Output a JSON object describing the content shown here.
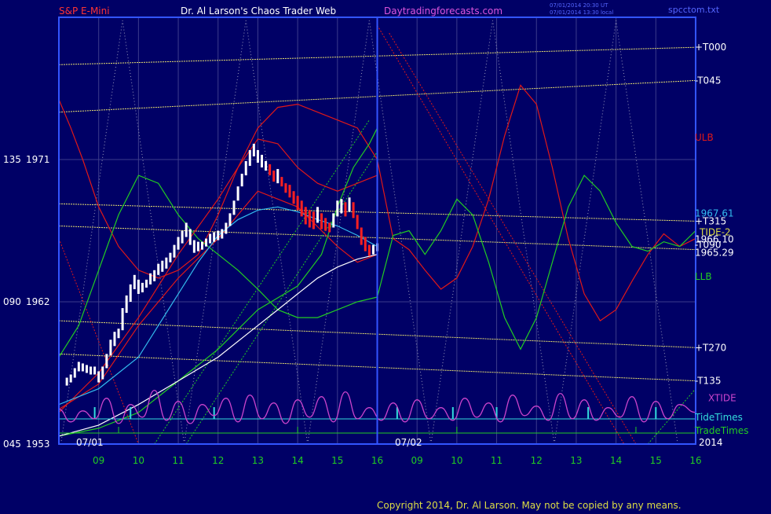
{
  "header": {
    "symbol": "S&P E-Mini",
    "title": "Dr. Al Larson's Chaos Trader Web",
    "site": "Daytradingforecasts.com",
    "stamp1": "07/01/2014 20:30 UT",
    "stamp2": "07/01/2014 13:30 local",
    "file": "spcctom.txt"
  },
  "footer": {
    "copyright": "Copyright 2014, Dr. Al Larson. May not be copied by any means."
  },
  "colors": {
    "background": "#000066",
    "frame": "#3355ff",
    "grid": "#3c3c8c",
    "price": "#ffffff",
    "down_bar": "#ff2020",
    "tide_red": "#e01818",
    "tide_green": "#22cc22",
    "yellow_line": "#e8e070",
    "xtide": "#cc44cc",
    "ma_cyan": "#33bbee",
    "tide_times": "#33dddd",
    "trade_times": "#22cc22"
  },
  "chart_data": {
    "type": "line",
    "y_axis_labels": [
      {
        "angle": "135",
        "price": "1971",
        "value": 1971
      },
      {
        "angle": "090",
        "price": "1962",
        "value": 1962
      },
      {
        "angle": "045",
        "price": "1953",
        "value": 1953
      }
    ],
    "ylim": [
      1953,
      1980
    ],
    "x_ticks_day1": [
      "09",
      "10",
      "11",
      "12",
      "13",
      "14",
      "15",
      "16"
    ],
    "x_ticks_day2": [
      "09",
      "10",
      "11",
      "12",
      "13",
      "14",
      "15",
      "16"
    ],
    "date_labels": {
      "day1": "07/01",
      "day2": "07/02",
      "year": "2014"
    },
    "right_labels": [
      {
        "text": "+T000",
        "value": 1978.1,
        "color": "#ffffff"
      },
      {
        "text": "-T045",
        "value": 1976.0,
        "color": "#ffffff"
      },
      {
        "text": "ULB",
        "value": 1972.4,
        "color": "#e01818"
      },
      {
        "text": "1967.61",
        "value": 1967.6,
        "color": "#33bbee"
      },
      {
        "text": "+T315",
        "value": 1967.1,
        "color": "#ffffff"
      },
      {
        "text": "TIDE-2",
        "value": 1966.4,
        "color": "#dddd44"
      },
      {
        "text": "1966.10",
        "value": 1965.95,
        "color": "#ffffff"
      },
      {
        "text": "-T090",
        "value": 1965.6,
        "color": "#ffffff"
      },
      {
        "text": "1965.29",
        "value": 1965.1,
        "color": "#ffffff"
      },
      {
        "text": "LLB",
        "value": 1963.6,
        "color": "#22cc22"
      },
      {
        "text": "+T270",
        "value": 1959.1,
        "color": "#ffffff"
      },
      {
        "text": "-T135",
        "value": 1957.0,
        "color": "#ffffff"
      },
      {
        "text": "XTIDE",
        "value": 1955.9,
        "color": "#cc44cc"
      },
      {
        "text": "TideTimes",
        "value": 1954.8,
        "color": "#33dddd"
      },
      {
        "text": "TradeTimes",
        "value": 1953.8,
        "color": "#22cc22"
      }
    ],
    "price_bars": [
      [
        8.2,
        1957.2,
        1956.7
      ],
      [
        8.3,
        1957.4,
        1956.9
      ],
      [
        8.4,
        1957.8,
        1957.2
      ],
      [
        8.5,
        1958.2,
        1957.6
      ],
      [
        8.6,
        1958.1,
        1957.6
      ],
      [
        8.7,
        1958.0,
        1957.5
      ],
      [
        8.8,
        1957.9,
        1957.4
      ],
      [
        8.9,
        1957.9,
        1957.4
      ],
      [
        9.0,
        1957.6,
        1956.9
      ],
      [
        9.1,
        1957.9,
        1957.1
      ],
      [
        9.2,
        1958.7,
        1957.8
      ],
      [
        9.3,
        1959.6,
        1958.6
      ],
      [
        9.4,
        1960.1,
        1959.2
      ],
      [
        9.5,
        1960.3,
        1959.7
      ],
      [
        9.6,
        1961.6,
        1960.2
      ],
      [
        9.7,
        1962.4,
        1961.3
      ],
      [
        9.8,
        1963.1,
        1962.0
      ],
      [
        9.9,
        1963.7,
        1962.8
      ],
      [
        10.0,
        1963.4,
        1962.5
      ],
      [
        10.1,
        1963.2,
        1962.6
      ],
      [
        10.2,
        1963.4,
        1962.9
      ],
      [
        10.3,
        1963.8,
        1963.1
      ],
      [
        10.4,
        1964.0,
        1963.3
      ],
      [
        10.5,
        1964.4,
        1963.7
      ],
      [
        10.6,
        1964.6,
        1963.9
      ],
      [
        10.7,
        1964.8,
        1964.1
      ],
      [
        10.8,
        1965.1,
        1964.5
      ],
      [
        10.9,
        1965.6,
        1964.8
      ],
      [
        11.0,
        1966.1,
        1965.3
      ],
      [
        11.1,
        1966.5,
        1965.7
      ],
      [
        11.2,
        1967.0,
        1966.1
      ],
      [
        11.3,
        1966.6,
        1965.6
      ],
      [
        11.4,
        1965.9,
        1965.1
      ],
      [
        11.5,
        1965.8,
        1965.2
      ],
      [
        11.6,
        1965.8,
        1965.3
      ],
      [
        11.7,
        1966.0,
        1965.5
      ],
      [
        11.8,
        1966.3,
        1965.7
      ],
      [
        11.9,
        1966.4,
        1965.8
      ],
      [
        12.0,
        1966.5,
        1965.9
      ],
      [
        12.1,
        1966.6,
        1966.0
      ],
      [
        12.2,
        1967.0,
        1966.3
      ],
      [
        12.3,
        1967.6,
        1966.8
      ],
      [
        12.4,
        1968.4,
        1967.5
      ],
      [
        12.5,
        1969.3,
        1968.4
      ],
      [
        12.6,
        1970.1,
        1969.3
      ],
      [
        12.7,
        1970.9,
        1970.0
      ],
      [
        12.8,
        1971.6,
        1970.6
      ],
      [
        12.9,
        1972.0,
        1971.2
      ],
      [
        13.0,
        1971.6,
        1970.8
      ],
      [
        13.1,
        1971.3,
        1970.5
      ],
      [
        13.2,
        1970.9,
        1970.3
      ],
      [
        13.3,
        1970.7,
        1970.0
      ],
      [
        13.4,
        1970.3,
        1969.6
      ],
      [
        13.5,
        1970.4,
        1969.5
      ],
      [
        13.6,
        1969.9,
        1969.3
      ],
      [
        13.7,
        1969.5,
        1968.9
      ],
      [
        13.8,
        1969.4,
        1968.6
      ],
      [
        13.9,
        1969.0,
        1968.2
      ],
      [
        14.0,
        1968.7,
        1967.8
      ],
      [
        14.1,
        1968.4,
        1967.4
      ],
      [
        14.2,
        1968.0,
        1966.9
      ],
      [
        14.3,
        1967.8,
        1966.7
      ],
      [
        14.4,
        1967.7,
        1966.6
      ],
      [
        14.5,
        1968.0,
        1967.0
      ],
      [
        14.6,
        1967.6,
        1966.6
      ],
      [
        14.7,
        1967.3,
        1966.5
      ],
      [
        14.8,
        1967.0,
        1966.4
      ],
      [
        14.9,
        1967.6,
        1966.7
      ],
      [
        15.0,
        1968.4,
        1967.4
      ],
      [
        15.1,
        1968.5,
        1967.6
      ],
      [
        15.2,
        1968.3,
        1967.4
      ],
      [
        15.3,
        1968.6,
        1967.7
      ],
      [
        15.4,
        1968.3,
        1967.3
      ],
      [
        15.5,
        1967.5,
        1966.6
      ],
      [
        15.6,
        1966.7,
        1965.6
      ],
      [
        15.7,
        1966.1,
        1965.2
      ],
      [
        15.8,
        1965.6,
        1964.9
      ],
      [
        15.9,
        1965.6,
        1965.0
      ],
      [
        16.0,
        1965.7,
        1965.2
      ]
    ],
    "series": [
      {
        "key": "ulb_red",
        "color": "#e01818",
        "x": [
          8.0,
          8.3,
          8.6,
          9.0,
          9.5,
          10.0,
          10.5,
          11.0,
          11.5,
          12.0,
          12.5,
          13.0,
          13.5,
          14.0,
          14.5,
          15.0,
          15.5,
          16.0,
          16.4,
          16.8,
          17.2,
          17.6,
          18.0,
          18.4,
          18.8,
          19.2,
          19.6,
          20.0,
          20.4,
          20.8,
          21.2,
          21.6,
          22.0,
          22.4,
          22.8,
          23.2,
          23.6,
          24.0
        ],
        "values": [
          1974.8,
          1973.0,
          1971.0,
          1968.0,
          1965.5,
          1964.0,
          1963.5,
          1964.0,
          1965.0,
          1967.5,
          1970.5,
          1973.0,
          1974.3,
          1974.5,
          1974.0,
          1973.5,
          1973.0,
          1971.0,
          1966.0,
          1965.3,
          1964.0,
          1962.8,
          1963.5,
          1965.5,
          1968.5,
          1972.5,
          1975.7,
          1974.5,
          1970.5,
          1966.0,
          1962.5,
          1960.8,
          1961.5,
          1963.3,
          1965.0,
          1966.3,
          1965.5,
          1966.0
        ]
      },
      {
        "key": "llb_green",
        "color": "#22cc22",
        "x": [
          8.0,
          8.5,
          9.0,
          9.5,
          10.0,
          10.5,
          11.0,
          11.5,
          12.0,
          12.5,
          13.0,
          13.5,
          14.0,
          14.5,
          15.0,
          15.5,
          16.0,
          16.4,
          16.8,
          17.2,
          17.6,
          18.0,
          18.4,
          18.8,
          19.2,
          19.6,
          20.0,
          20.4,
          20.8,
          21.2,
          21.6,
          22.0,
          22.4,
          22.8,
          23.2,
          23.6,
          24.0
        ],
        "values": [
          1958.5,
          1960.5,
          1964.0,
          1967.5,
          1970.0,
          1969.5,
          1967.5,
          1966.0,
          1965.0,
          1964.0,
          1962.8,
          1961.5,
          1961.0,
          1961.0,
          1961.5,
          1962.0,
          1962.3,
          1966.2,
          1966.5,
          1965.0,
          1966.5,
          1968.5,
          1967.5,
          1964.5,
          1961.0,
          1959.0,
          1961.0,
          1964.5,
          1968.0,
          1970.0,
          1969.0,
          1967.0,
          1965.5,
          1965.2,
          1965.8,
          1965.5,
          1966.5
        ]
      },
      {
        "key": "red_envelope_upper",
        "color": "#e01818",
        "x": [
          8.0,
          9.0,
          10.0,
          11.0,
          12.0,
          12.5,
          13.0,
          13.5,
          14.0,
          14.5,
          15.0,
          15.5,
          16.0
        ],
        "values": [
          1955.0,
          1957.5,
          1961.0,
          1965.0,
          1968.5,
          1970.5,
          1972.3,
          1972.0,
          1970.5,
          1969.5,
          1969.0,
          1969.5,
          1970.0
        ]
      },
      {
        "key": "red_envelope_lower",
        "color": "#e01818",
        "x": [
          8.0,
          9.0,
          10.0,
          11.0,
          12.0,
          13.0,
          14.0,
          15.0,
          15.5,
          16.0
        ],
        "values": [
          1955.2,
          1956.8,
          1960.5,
          1963.5,
          1966.0,
          1969.0,
          1968.0,
          1965.5,
          1964.5,
          1965.0
        ]
      },
      {
        "key": "green_envelope",
        "color": "#22cc22",
        "x": [
          8.0,
          9.0,
          10.0,
          11.0,
          12.0,
          13.0,
          14.0,
          14.6,
          15.0,
          15.4,
          15.8,
          16.0
        ],
        "values": [
          1953.5,
          1954.0,
          1955.0,
          1957.0,
          1959.0,
          1961.5,
          1963.0,
          1965.0,
          1968.0,
          1970.5,
          1972.0,
          1973.0
        ]
      },
      {
        "key": "moving_average_cyan",
        "color": "#33bbee",
        "x": [
          8.0,
          9.0,
          10.0,
          10.5,
          11.0,
          11.5,
          12.0,
          12.5,
          13.0,
          13.5,
          14.0,
          14.5,
          15.0,
          15.5,
          16.0
        ],
        "values": [
          1955.5,
          1956.5,
          1958.5,
          1960.5,
          1962.5,
          1964.5,
          1966.2,
          1967.2,
          1967.8,
          1968.0,
          1967.7,
          1967.2,
          1966.8,
          1966.2,
          1965.5
        ]
      },
      {
        "key": "moving_average_white",
        "color": "#ffffff",
        "x": [
          8.0,
          9.0,
          10.0,
          11.0,
          12.0,
          13.0,
          13.5,
          14.0,
          14.5,
          15.0,
          15.5,
          16.0
        ],
        "values": [
          1953.5,
          1954.2,
          1955.5,
          1957.0,
          1958.5,
          1960.5,
          1961.5,
          1962.5,
          1963.5,
          1964.2,
          1964.7,
          1965.0
        ]
      },
      {
        "key": "yellow_T000",
        "color": "#e8e070",
        "x": [
          8.0,
          24.0
        ],
        "values": [
          1977.0,
          1978.1
        ]
      },
      {
        "key": "yellow_T045",
        "color": "#e8e070",
        "x": [
          8.0,
          24.0
        ],
        "values": [
          1974.0,
          1976.0
        ]
      },
      {
        "key": "yellow_T315",
        "color": "#e8e070",
        "x": [
          8.0,
          24.0
        ],
        "values": [
          1968.2,
          1967.1
        ]
      },
      {
        "key": "yellow_T090",
        "color": "#e8e070",
        "x": [
          8.0,
          24.0
        ],
        "values": [
          1966.8,
          1965.3
        ]
      },
      {
        "key": "yellow_T270",
        "color": "#e8e070",
        "x": [
          8.0,
          24.0
        ],
        "values": [
          1960.8,
          1959.1
        ]
      },
      {
        "key": "yellow_T135",
        "color": "#e8e070",
        "x": [
          8.0,
          24.0
        ],
        "values": [
          1958.7,
          1957.0
        ]
      }
    ],
    "xtide_series": {
      "color": "#cc44cc",
      "x": [
        8.0,
        8.3,
        8.6,
        8.9,
        9.2,
        9.5,
        9.8,
        10.1,
        10.4,
        10.7,
        11.0,
        11.3,
        11.6,
        11.9,
        12.2,
        12.5,
        12.8,
        13.1,
        13.4,
        13.7,
        14.0,
        14.3,
        14.6,
        14.9,
        15.2,
        15.5,
        15.8,
        16.1,
        16.4,
        16.7,
        17.0,
        17.3,
        17.6,
        17.9,
        18.2,
        18.5,
        18.8,
        19.1,
        19.4,
        19.7,
        20.0,
        20.3,
        20.6,
        20.9,
        21.2,
        21.5,
        21.8,
        22.1,
        22.4,
        22.7,
        23.0,
        23.3,
        23.6,
        24.0
      ],
      "values": [
        1955.2,
        1954.4,
        1955.1,
        1954.6,
        1955.9,
        1954.3,
        1955.5,
        1954.7,
        1956.4,
        1954.5,
        1955.7,
        1954.3,
        1955.5,
        1954.8,
        1955.9,
        1954.4,
        1956.1,
        1954.6,
        1955.6,
        1954.3,
        1955.8,
        1954.7,
        1956.0,
        1954.4,
        1956.3,
        1954.6,
        1955.3,
        1954.5,
        1955.6,
        1954.4,
        1955.8,
        1954.6,
        1955.3,
        1954.5,
        1955.9,
        1954.7,
        1955.6,
        1954.4,
        1956.1,
        1954.8,
        1955.4,
        1954.5,
        1956.2,
        1954.6,
        1955.8,
        1954.5,
        1955.3,
        1954.7,
        1956.0,
        1954.4,
        1955.7,
        1954.6,
        1955.5,
        1955.0
      ]
    },
    "tide_time_marks": [
      8.9,
      9.8,
      11.9,
      16.5,
      17.9,
      19.0,
      21.3,
      23.0
    ],
    "trade_time_marks": [
      9.5,
      14.0,
      18.0,
      22.5
    ],
    "diamond_lattice": {
      "top_value": 1979.8,
      "bottom_value": 1953.0,
      "peak_times": [
        9.6,
        12.7,
        15.8,
        18.9,
        22.0
      ],
      "trough_times": [
        8.05,
        11.15,
        14.25,
        17.35,
        20.45,
        23.55
      ]
    },
    "trend_lines": [
      {
        "color": "#22cc22",
        "x": [
          10.4,
          15.8
        ],
        "values": [
          1953.0,
          1973.5
        ]
      },
      {
        "color": "#22cc22",
        "x": [
          11.2,
          16.0
        ],
        "values": [
          1953.0,
          1971.5
        ]
      },
      {
        "color": "#e01818",
        "x": [
          8.0,
          10.0
        ],
        "values": [
          1966.0,
          1953.0
        ]
      },
      {
        "color": "#e01818",
        "x": [
          16.0,
          22.2
        ],
        "values": [
          1979.5,
          1953.0
        ]
      },
      {
        "color": "#e01818",
        "x": [
          16.3,
          22.5
        ],
        "values": [
          1979.0,
          1953.0
        ]
      },
      {
        "color": "#22cc22",
        "x": [
          22.8,
          24.0
        ],
        "values": [
          1953.0,
          1956.5
        ]
      }
    ]
  }
}
